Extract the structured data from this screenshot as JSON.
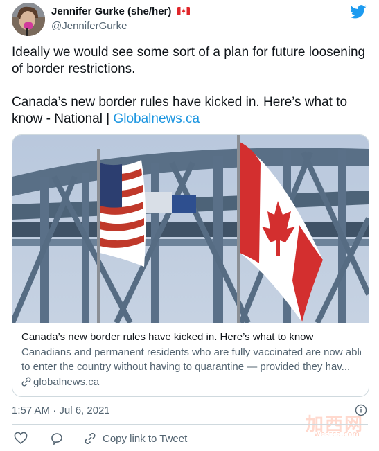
{
  "author": {
    "name": "Jennifer Gurke (she/her)",
    "handle": "@JenniferGurke",
    "flag_emoji": "canada-flag"
  },
  "tweet": {
    "text": "Ideally we would see some sort of a plan for future loosening of border restrictions.",
    "text2_prefix": "Canada’s new border rules have kicked in. Here’s what to know - National | ",
    "text2_link": "Globalnews.ca"
  },
  "card": {
    "title": "Canada’s new border rules have kicked in. Here’s what to know",
    "desc_line1": "Canadians and permanent residents who are fully vaccinated are now able",
    "desc_line2": "to enter the country without having to quarantine — provided they hav...",
    "domain": "globalnews.ca",
    "image": "us-and-canada-flags-in-front-of-bridge"
  },
  "meta": {
    "timestamp": "1:57 AM · Jul 6, 2021"
  },
  "actions": {
    "copy_link": "Copy link to Tweet"
  },
  "watermark": {
    "text": "加西网",
    "sub": "westca.com"
  },
  "colors": {
    "twitter_blue": "#1d9bf0",
    "link": "#1b95e0",
    "secondary_text": "#536471"
  }
}
